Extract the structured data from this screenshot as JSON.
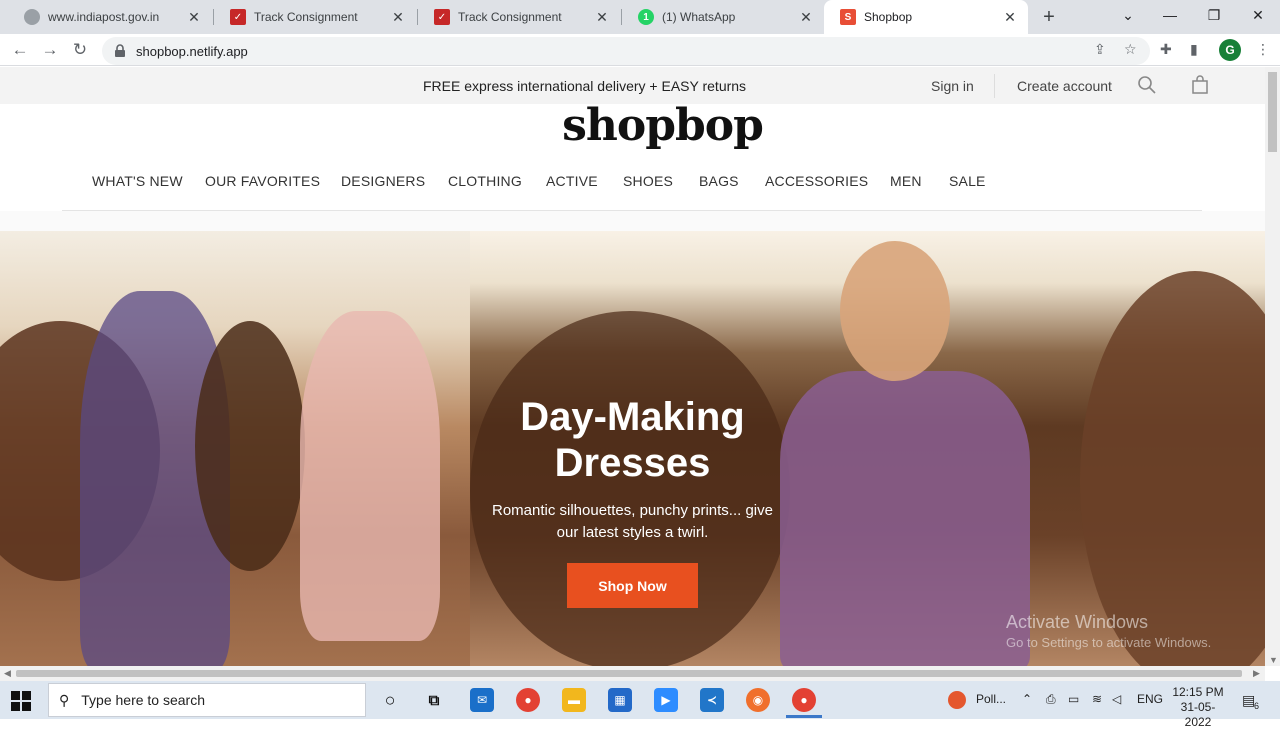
{
  "browser": {
    "tabs": [
      {
        "title": "www.indiapost.gov.in",
        "favicon": "globe-icon",
        "active": false
      },
      {
        "title": "Track Consignment",
        "favicon": "india-post-icon",
        "active": false
      },
      {
        "title": "Track Consignment",
        "favicon": "india-post-icon",
        "active": false
      },
      {
        "title": "(1) WhatsApp",
        "favicon": "whatsapp-icon",
        "active": false
      },
      {
        "title": "Shopbop",
        "favicon": "shopbop-icon",
        "active": true
      }
    ],
    "new_tab_label": "+",
    "url": "shopbop.netlify.app",
    "profile_initial": "G",
    "wa_badge": "1",
    "shop_favicon_letter": "S"
  },
  "page": {
    "promo": {
      "text": "FREE express international delivery + EASY returns",
      "sign_in": "Sign in",
      "create_account": "Create account"
    },
    "logo": "shopbop",
    "nav": [
      "WHAT'S NEW",
      "OUR FAVORITES",
      "DESIGNERS",
      "CLOTHING",
      "ACTIVE",
      "SHOES",
      "BAGS",
      "ACCESSORIES",
      "MEN",
      "SALE"
    ],
    "hero": {
      "title_line1": "Day-Making",
      "title_line2": "Dresses",
      "subtitle_line1": "Romantic silhouettes, punchy prints... give",
      "subtitle_line2": "our latest styles a twirl.",
      "cta": "Shop Now",
      "cta_color": "#e8501f"
    },
    "watermark": {
      "line1": "Activate Windows",
      "line2": "Go to Settings to activate Windows."
    }
  },
  "taskbar": {
    "search_placeholder": "Type here to search",
    "pinned_app_label": "Poll...",
    "language": "ENG",
    "time": "12:15 PM",
    "date": "31-05-2022",
    "notification_count": "6"
  }
}
